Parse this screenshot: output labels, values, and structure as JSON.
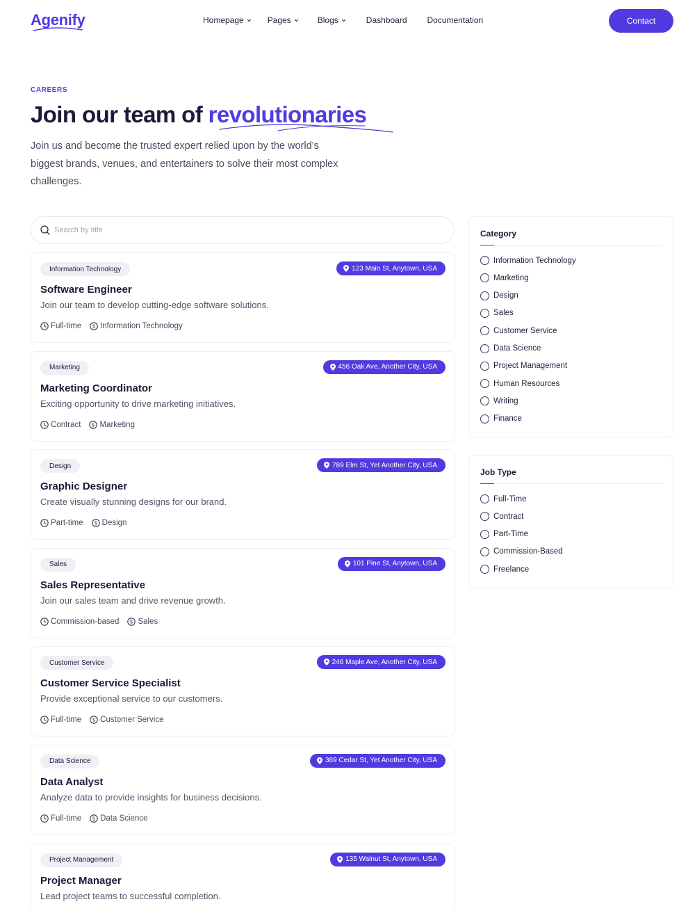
{
  "brand": {
    "name": "Agenify",
    "accent": "#4f3be0"
  },
  "nav": {
    "items": [
      {
        "label": "Homepage",
        "has_dropdown": true
      },
      {
        "label": "Pages",
        "has_dropdown": true
      },
      {
        "label": "Blogs",
        "has_dropdown": true
      },
      {
        "label": "Dashboard",
        "has_dropdown": false
      },
      {
        "label": "Documentation",
        "has_dropdown": false
      }
    ],
    "contact_label": "Contact"
  },
  "hero": {
    "eyebrow": "CAREERS",
    "title_prefix": "Join our team of ",
    "title_accent": "revolutionaries",
    "description": "Join us and become the trusted expert relied upon by the world’s biggest brands, venues, and entertainers to solve their most complex challenges."
  },
  "search": {
    "placeholder": "Search by title",
    "value": ""
  },
  "jobs": [
    {
      "tag": "Information Technology",
      "location": "123 Main St, Anytown, USA",
      "title": "Software Engineer",
      "description": "Join our team to develop cutting-edge software solutions.",
      "type": "Full-time",
      "category": "Information Technology"
    },
    {
      "tag": "Marketing",
      "location": "456 Oak Ave, Another City, USA",
      "title": "Marketing Coordinator",
      "description": "Exciting opportunity to drive marketing initiatives.",
      "type": "Contract",
      "category": "Marketing"
    },
    {
      "tag": "Design",
      "location": "789 Elm St, Yet Another City, USA",
      "title": "Graphic Designer",
      "description": "Create visually stunning designs for our brand.",
      "type": "Part-time",
      "category": "Design"
    },
    {
      "tag": "Sales",
      "location": "101 Pine St, Anytown, USA",
      "title": "Sales Representative",
      "description": "Join our sales team and drive revenue growth.",
      "type": "Commission-based",
      "category": "Sales"
    },
    {
      "tag": "Customer Service",
      "location": "246 Maple Ave, Another City, USA",
      "title": "Customer Service Specialist",
      "description": "Provide exceptional service to our customers.",
      "type": "Full-time",
      "category": "Customer Service"
    },
    {
      "tag": "Data Science",
      "location": "369 Cedar St, Yet Another City, USA",
      "title": "Data Analyst",
      "description": "Analyze data to provide insights for business decisions.",
      "type": "Full-time",
      "category": "Data Science"
    },
    {
      "tag": "Project Management",
      "location": "135 Walnut St, Anytown, USA",
      "title": "Project Manager",
      "description": "Lead project teams to successful completion.",
      "type": "",
      "category": ""
    }
  ],
  "filters": {
    "category": {
      "title": "Category",
      "options": [
        "Information Technology",
        "Marketing",
        "Design",
        "Sales",
        "Customer Service",
        "Data Science",
        "Project Management",
        "Human Resources",
        "Writing",
        "Finance"
      ]
    },
    "job_type": {
      "title": "Job Type",
      "options": [
        "Full-Time",
        "Contract",
        "Part-Time",
        "Commission-Based",
        "Freelance"
      ]
    }
  }
}
